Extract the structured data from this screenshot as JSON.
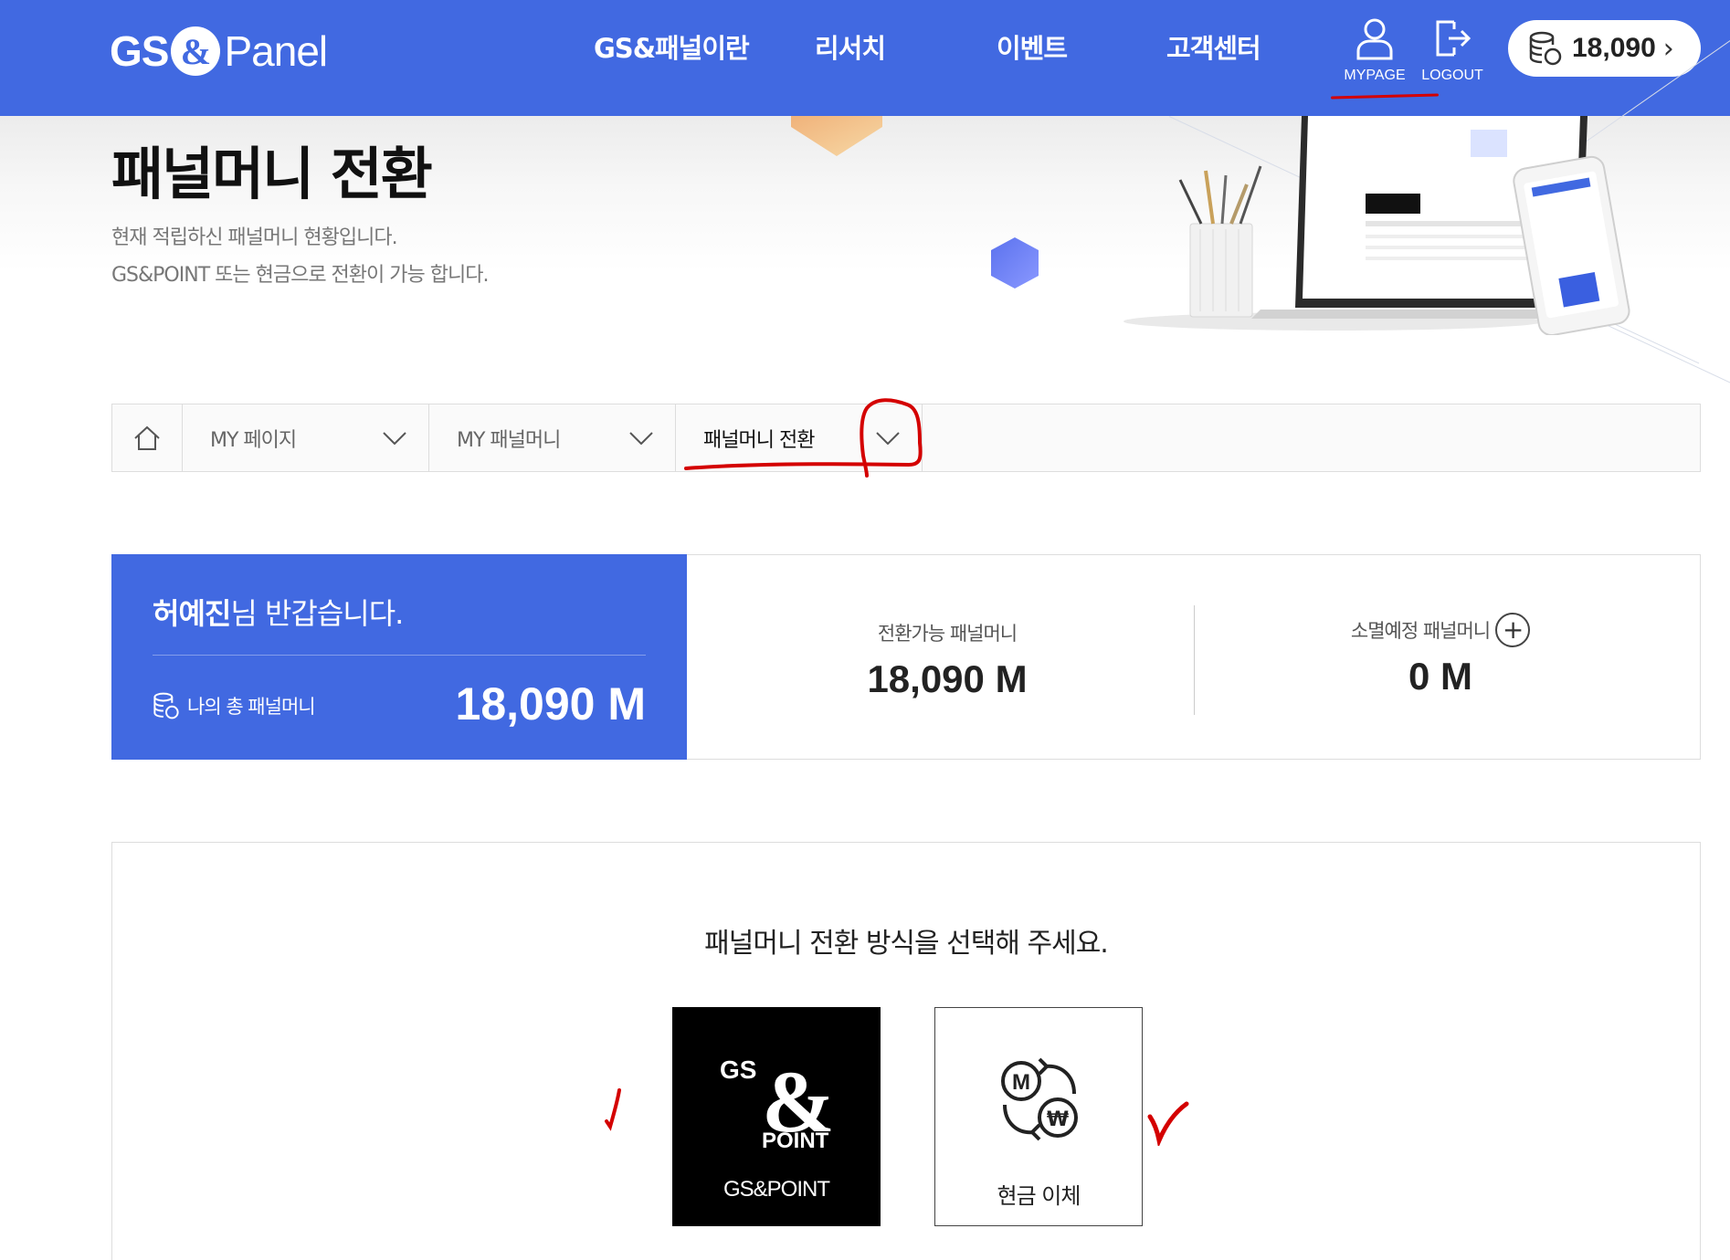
{
  "header": {
    "logo": {
      "gs": "GS",
      "amp": "&",
      "panel": "Panel"
    },
    "nav": [
      "GS&패널이란",
      "리서치",
      "이벤트",
      "고객센터"
    ],
    "mypage_label": "MYPAGE",
    "logout_label": "LOGOUT",
    "points": "18,090"
  },
  "hero": {
    "title": "패널머니 전환",
    "desc_line1": "현재 적립하신 패널머니 현황입니다.",
    "desc_line2": "GS&POINT 또는 현금으로 전환이 가능 합니다."
  },
  "breadcrumb": {
    "items": [
      {
        "label": "MY 페이지"
      },
      {
        "label": "MY 패널머니"
      },
      {
        "label": "패널머니 전환"
      }
    ]
  },
  "summary": {
    "user_name": "허예진",
    "greeting_suffix": "님 반갑습니다.",
    "total_label": "나의 총 패널머니",
    "total_value": "18,090 M",
    "convertible_label": "전환가능 패널머니",
    "convertible_value": "18,090 M",
    "expiring_label": "소멸예정 패널머니",
    "expiring_value": "0 M"
  },
  "conversion": {
    "prompt": "패널머니 전환 방식을 선택해 주세요.",
    "options": [
      {
        "label": "GS&POINT",
        "logo_gs": "GS",
        "logo_amp": "&",
        "logo_point": "POINT"
      },
      {
        "label": "현금 이체",
        "icon_m": "M",
        "icon_won": "₩"
      }
    ]
  },
  "colors": {
    "brand_blue": "#4169e1",
    "annotation_red": "#d40000"
  }
}
